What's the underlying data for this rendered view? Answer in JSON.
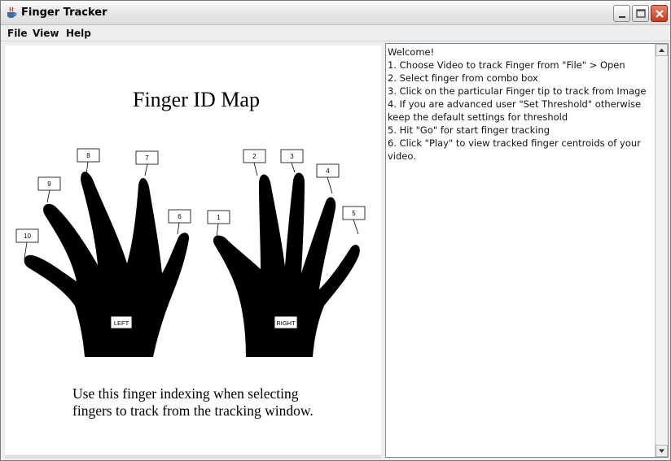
{
  "window": {
    "title": "Finger Tracker",
    "icon": "java-cup-icon"
  },
  "menubar": {
    "items": [
      {
        "label": "File"
      },
      {
        "label": "View"
      },
      {
        "label": "Help"
      }
    ]
  },
  "finger_map": {
    "heading": "Finger ID Map",
    "left_hand_label": "LEFT",
    "right_hand_label": "RIGHT",
    "finger_ids": [
      "1",
      "2",
      "3",
      "4",
      "5",
      "6",
      "7",
      "8",
      "9",
      "10"
    ],
    "instruction_line1": "Use this finger indexing when selecting",
    "instruction_line2": "fingers to track from the tracking window."
  },
  "log": {
    "lines": [
      "Welcome!",
      "1. Choose Video to track Finger from \"File\" > Open",
      "2. Select finger from combo box",
      "3. Click on the particular Finger tip to track from Image",
      "4. If you are advanced user \"Set Threshold\" otherwise keep the default settings for threshold",
      "5. Hit \"Go\" for start finger tracking",
      "6. Click \"Play\" to view tracked finger centroids of your video."
    ]
  },
  "colors": {
    "hand_fill": "#000000",
    "close_button": "#c63a1f"
  }
}
